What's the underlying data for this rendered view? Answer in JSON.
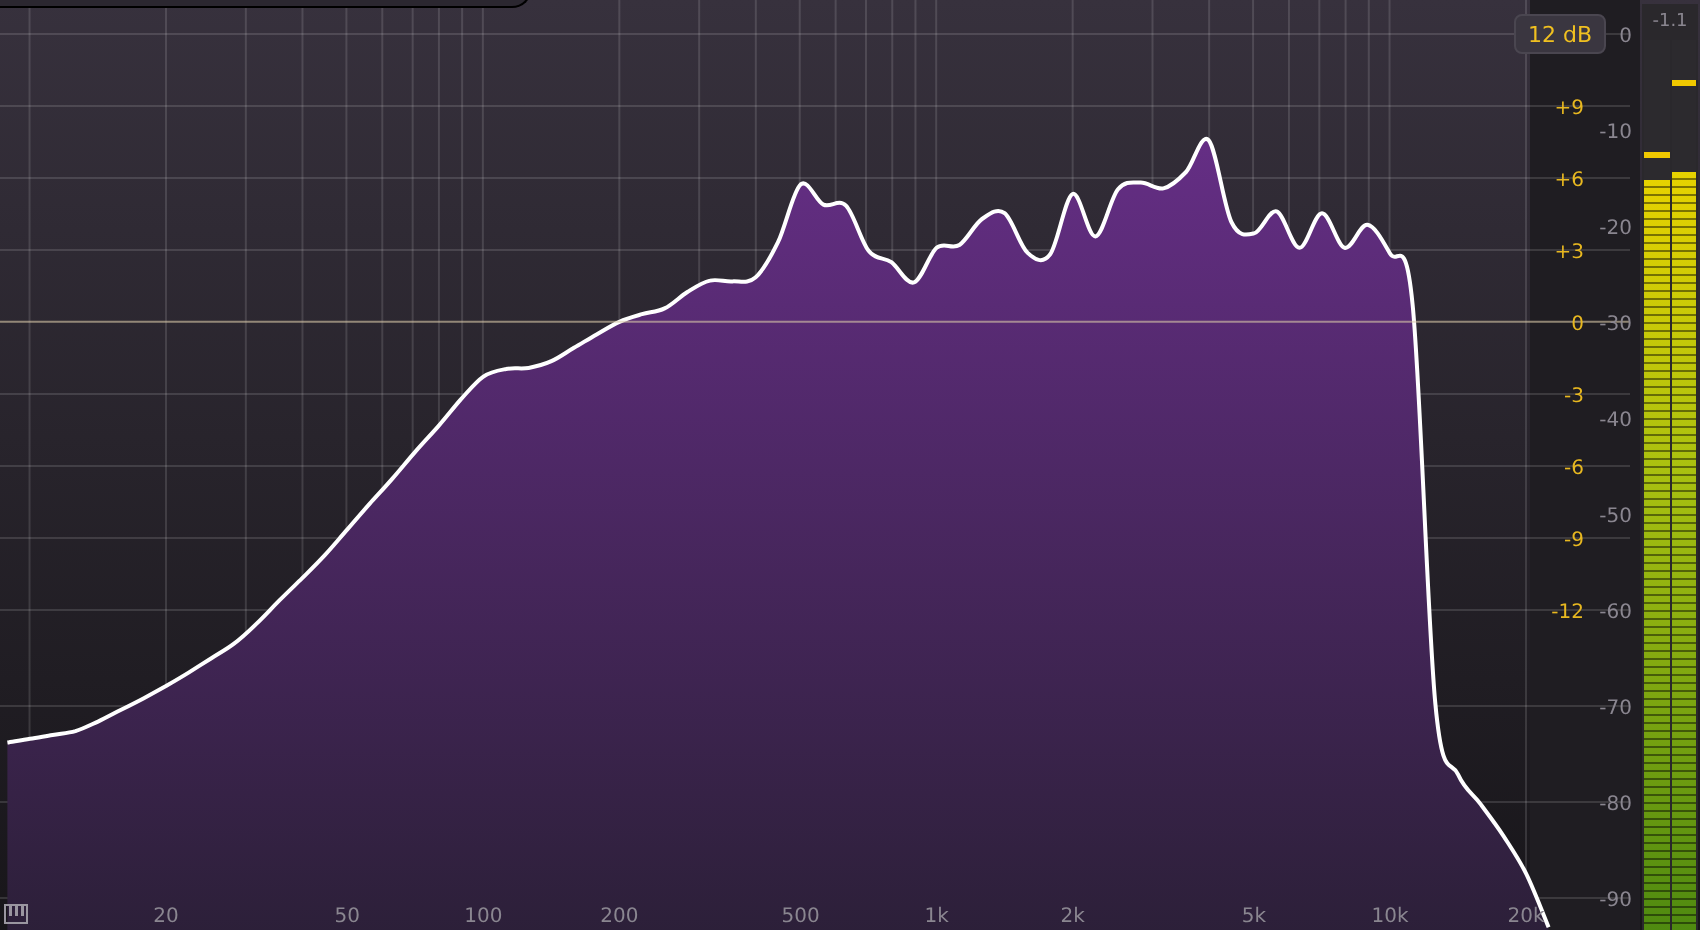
{
  "range_button": {
    "label": "12 dB"
  },
  "gain_scale": [
    "+9",
    "+6",
    "+3",
    "0",
    "-3",
    "-6",
    "-9",
    "-12"
  ],
  "spectrum": {
    "chart_data": {
      "type": "area",
      "grid": true,
      "ref_lines": [
        {
          "axis": "y",
          "value": -30
        }
      ],
      "ylim": [
        -93.3,
        3.5
      ],
      "yticks": [
        {
          "value": 0,
          "label": "0"
        },
        {
          "value": -10,
          "label": "-10"
        },
        {
          "value": -20,
          "label": "-20"
        },
        {
          "value": -30,
          "label": "-30"
        },
        {
          "value": -40,
          "label": "-40"
        },
        {
          "value": -50,
          "label": "-50"
        },
        {
          "value": -60,
          "label": "-60"
        },
        {
          "value": -70,
          "label": "-70"
        },
        {
          "value": -80,
          "label": "-80"
        },
        {
          "value": -90,
          "label": "-90"
        }
      ],
      "categories": [
        null,
        null,
        null,
        null,
        null,
        null,
        null,
        "20",
        null,
        null,
        null,
        null,
        null,
        null,
        null,
        "50",
        null,
        null,
        null,
        null,
        null,
        "100",
        null,
        null,
        null,
        null,
        null,
        "200",
        null,
        null,
        null,
        null,
        null,
        null,
        null,
        "500",
        null,
        null,
        null,
        null,
        null,
        "1k",
        null,
        null,
        null,
        null,
        null,
        "2k",
        null,
        null,
        null,
        null,
        null,
        null,
        null,
        "5k",
        null,
        null,
        null,
        null,
        null,
        "10k",
        null,
        null,
        null,
        null,
        null,
        "20k",
        null
      ],
      "series": [
        {
          "color": "#ffffff",
          "values": [
            -73.8,
            -73.4,
            -73,
            -72.6,
            -71.6,
            -70.4,
            -69.2,
            -67.9,
            -66.5,
            -65,
            -63.5,
            -61.4,
            -59,
            -56.7,
            -54.3,
            -51.6,
            -48.9,
            -46.3,
            -43.5,
            -40.9,
            -38.1,
            -35.7,
            -34.9,
            -34.8,
            -34.1,
            -32.7,
            -31.3,
            -30,
            -29.2,
            -28.6,
            -26.9,
            -25.7,
            -25.8,
            -25.4,
            -21.7,
            -15.7,
            -17.8,
            -17.9,
            -22.6,
            -23.8,
            -25.9,
            -22.3,
            -22,
            -19.3,
            -18.7,
            -22.8,
            -23,
            -16.7,
            -21.1,
            -16.2,
            -15.5,
            -16.1,
            -14.4,
            -11.1,
            -19.6,
            -20.8,
            -18.5,
            -22.3,
            -18.7,
            -22.3,
            -19.9,
            -22.9,
            -28.2,
            -69.8,
            -77.1,
            -80.2,
            -83.5,
            -87.4,
            -93
          ]
        }
      ]
    }
  },
  "meter": {
    "peak_reading": "-1.1",
    "channels": [
      {
        "level": 0.843,
        "peak": {
          "level": 0.867
        }
      },
      {
        "level": 0.852,
        "peak": {
          "level": 0.948
        }
      }
    ]
  }
}
